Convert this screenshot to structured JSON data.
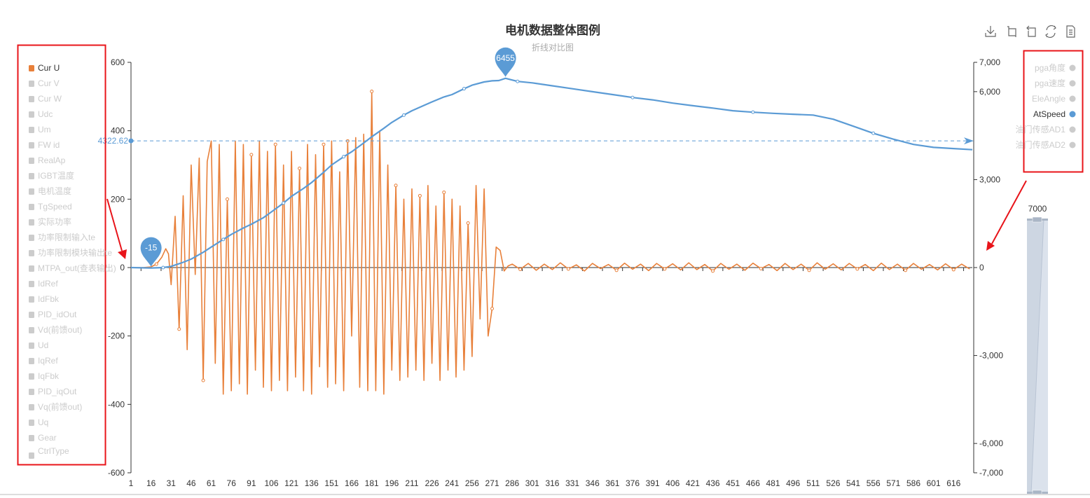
{
  "chart_data": {
    "type": "line",
    "title": "电机数据整体图例",
    "subtitle": "折线对比图",
    "x_range": [
      1,
      630
    ],
    "x_tick_labels": [
      "1",
      "16",
      "31",
      "46",
      "61",
      "76",
      "91",
      "106",
      "121",
      "136",
      "151",
      "166",
      "181",
      "196",
      "211",
      "226",
      "241",
      "256",
      "271",
      "286",
      "301",
      "316",
      "331",
      "346",
      "361",
      "376",
      "391",
      "406",
      "421",
      "436",
      "451",
      "466",
      "481",
      "496",
      "511",
      "526",
      "541",
      "556",
      "571",
      "586",
      "601",
      "616"
    ],
    "y_left": {
      "range": [
        -600,
        600
      ],
      "ticks": [
        "600",
        "400",
        "200",
        "0",
        "-200",
        "-400",
        "-600"
      ],
      "values": [
        600,
        400,
        200,
        0,
        -200,
        -400,
        -600
      ]
    },
    "y_right": {
      "range": [
        -7000,
        7000
      ],
      "ticks": [
        "7,000",
        "6,000",
        "3,000",
        "0",
        "-3,000",
        "-6,000",
        "-7,000"
      ],
      "values": [
        7000,
        6000,
        3000,
        0,
        -3000,
        -6000,
        -7000
      ]
    },
    "grid": false,
    "series": [
      {
        "name": "Cur U",
        "axis": "left",
        "color": "#e8803a",
        "points": [
          [
            1,
            0
          ],
          [
            10,
            0
          ],
          [
            16,
            2
          ],
          [
            20,
            10
          ],
          [
            24,
            30
          ],
          [
            27,
            55
          ],
          [
            29,
            40
          ],
          [
            31,
            -50
          ],
          [
            34,
            150
          ],
          [
            37,
            -180
          ],
          [
            40,
            210
          ],
          [
            43,
            -240
          ],
          [
            46,
            300
          ],
          [
            49,
            -20
          ],
          [
            52,
            320
          ],
          [
            55,
            -330
          ],
          [
            58,
            310
          ],
          [
            61,
            370
          ],
          [
            64,
            -280
          ],
          [
            67,
            360
          ],
          [
            70,
            -370
          ],
          [
            73,
            200
          ],
          [
            76,
            -360
          ],
          [
            79,
            370
          ],
          [
            82,
            -340
          ],
          [
            85,
            360
          ],
          [
            88,
            -370
          ],
          [
            91,
            330
          ],
          [
            94,
            -300
          ],
          [
            97,
            370
          ],
          [
            100,
            -350
          ],
          [
            103,
            340
          ],
          [
            106,
            -360
          ],
          [
            109,
            360
          ],
          [
            112,
            -330
          ],
          [
            115,
            300
          ],
          [
            118,
            -360
          ],
          [
            121,
            340
          ],
          [
            124,
            -320
          ],
          [
            127,
            290
          ],
          [
            130,
            -360
          ],
          [
            133,
            360
          ],
          [
            136,
            -370
          ],
          [
            139,
            330
          ],
          [
            142,
            -290
          ],
          [
            145,
            360
          ],
          [
            148,
            -350
          ],
          [
            151,
            370
          ],
          [
            154,
            -340
          ],
          [
            157,
            280
          ],
          [
            160,
            -360
          ],
          [
            163,
            370
          ],
          [
            166,
            -200
          ],
          [
            169,
            380
          ],
          [
            172,
            -350
          ],
          [
            175,
            390
          ],
          [
            178,
            -360
          ],
          [
            181,
            515
          ],
          [
            184,
            -360
          ],
          [
            187,
            400
          ],
          [
            190,
            -370
          ],
          [
            193,
            300
          ],
          [
            196,
            -300
          ],
          [
            199,
            240
          ],
          [
            202,
            -330
          ],
          [
            205,
            200
          ],
          [
            208,
            -320
          ],
          [
            211,
            230
          ],
          [
            214,
            -300
          ],
          [
            217,
            210
          ],
          [
            220,
            -330
          ],
          [
            223,
            240
          ],
          [
            226,
            -280
          ],
          [
            229,
            180
          ],
          [
            232,
            -330
          ],
          [
            235,
            220
          ],
          [
            238,
            -300
          ],
          [
            241,
            200
          ],
          [
            244,
            -320
          ],
          [
            247,
            180
          ],
          [
            250,
            -300
          ],
          [
            253,
            130
          ],
          [
            256,
            -260
          ],
          [
            259,
            240
          ],
          [
            262,
            -150
          ],
          [
            265,
            230
          ],
          [
            268,
            -200
          ],
          [
            271,
            -120
          ],
          [
            274,
            60
          ],
          [
            277,
            50
          ],
          [
            280,
            -10
          ],
          [
            283,
            5
          ],
          [
            286,
            10
          ],
          [
            292,
            -5
          ],
          [
            298,
            12
          ],
          [
            304,
            -8
          ],
          [
            310,
            10
          ],
          [
            316,
            -6
          ],
          [
            322,
            14
          ],
          [
            328,
            -4
          ],
          [
            334,
            8
          ],
          [
            340,
            -10
          ],
          [
            346,
            12
          ],
          [
            352,
            -3
          ],
          [
            358,
            9
          ],
          [
            364,
            -8
          ],
          [
            370,
            13
          ],
          [
            376,
            -5
          ],
          [
            382,
            10
          ],
          [
            388,
            -9
          ],
          [
            394,
            12
          ],
          [
            400,
            -4
          ],
          [
            406,
            11
          ],
          [
            412,
            -7
          ],
          [
            418,
            14
          ],
          [
            424,
            -6
          ],
          [
            430,
            9
          ],
          [
            436,
            -10
          ],
          [
            442,
            12
          ],
          [
            448,
            -5
          ],
          [
            454,
            10
          ],
          [
            460,
            -8
          ],
          [
            466,
            13
          ],
          [
            472,
            -3
          ],
          [
            478,
            9
          ],
          [
            484,
            -9
          ],
          [
            490,
            12
          ],
          [
            496,
            -6
          ],
          [
            502,
            10
          ],
          [
            508,
            -8
          ],
          [
            514,
            14
          ],
          [
            520,
            -5
          ],
          [
            526,
            11
          ],
          [
            532,
            -7
          ],
          [
            538,
            12
          ],
          [
            544,
            -4
          ],
          [
            550,
            9
          ],
          [
            556,
            -9
          ],
          [
            562,
            13
          ],
          [
            568,
            -6
          ],
          [
            574,
            10
          ],
          [
            580,
            -8
          ],
          [
            586,
            12
          ],
          [
            592,
            -5
          ],
          [
            598,
            9
          ],
          [
            604,
            -7
          ],
          [
            610,
            11
          ],
          [
            616,
            -6
          ],
          [
            622,
            10
          ],
          [
            628,
            -4
          ]
        ]
      },
      {
        "name": "AtSpeed",
        "axis": "right",
        "color": "#5b9bd5",
        "points": [
          [
            1,
            0
          ],
          [
            10,
            -10
          ],
          [
            16,
            -15
          ],
          [
            25,
            0
          ],
          [
            31,
            40
          ],
          [
            40,
            180
          ],
          [
            46,
            290
          ],
          [
            55,
            520
          ],
          [
            61,
            700
          ],
          [
            70,
            960
          ],
          [
            76,
            1130
          ],
          [
            85,
            1350
          ],
          [
            91,
            1480
          ],
          [
            100,
            1700
          ],
          [
            106,
            1900
          ],
          [
            115,
            2200
          ],
          [
            121,
            2430
          ],
          [
            130,
            2700
          ],
          [
            136,
            2900
          ],
          [
            145,
            3250
          ],
          [
            151,
            3500
          ],
          [
            160,
            3780
          ],
          [
            166,
            3950
          ],
          [
            175,
            4250
          ],
          [
            181,
            4460
          ],
          [
            190,
            4750
          ],
          [
            196,
            4950
          ],
          [
            205,
            5200
          ],
          [
            211,
            5350
          ],
          [
            220,
            5530
          ],
          [
            226,
            5650
          ],
          [
            235,
            5820
          ],
          [
            241,
            5900
          ],
          [
            250,
            6100
          ],
          [
            256,
            6220
          ],
          [
            265,
            6330
          ],
          [
            271,
            6370
          ],
          [
            276,
            6380
          ],
          [
            281,
            6455
          ],
          [
            290,
            6350
          ],
          [
            301,
            6300
          ],
          [
            316,
            6200
          ],
          [
            331,
            6100
          ],
          [
            346,
            6000
          ],
          [
            361,
            5900
          ],
          [
            376,
            5800
          ],
          [
            391,
            5720
          ],
          [
            406,
            5610
          ],
          [
            421,
            5520
          ],
          [
            436,
            5440
          ],
          [
            451,
            5350
          ],
          [
            466,
            5300
          ],
          [
            481,
            5260
          ],
          [
            496,
            5230
          ],
          [
            511,
            5200
          ],
          [
            526,
            5060
          ],
          [
            541,
            4820
          ],
          [
            556,
            4580
          ],
          [
            571,
            4380
          ],
          [
            586,
            4200
          ],
          [
            601,
            4100
          ],
          [
            616,
            4060
          ],
          [
            630,
            4020
          ]
        ],
        "mark_point_max": {
          "x": 281,
          "value": 6455,
          "label": "6455"
        },
        "mark_point_min": {
          "x": 16,
          "value": -15,
          "label": "-15"
        },
        "mark_line_average": {
          "value": 4322.62,
          "label": "4322.62"
        }
      }
    ],
    "legend_left": {
      "placement": "left",
      "items": [
        {
          "label": "Cur U",
          "active": true
        },
        {
          "label": "Cur V",
          "active": false
        },
        {
          "label": "Cur W",
          "active": false
        },
        {
          "label": "Udc",
          "active": false
        },
        {
          "label": "Um",
          "active": false
        },
        {
          "label": "FW id",
          "active": false
        },
        {
          "label": "RealAp",
          "active": false
        },
        {
          "label": "IGBT温度",
          "active": false
        },
        {
          "label": "电机温度",
          "active": false
        },
        {
          "label": "TgSpeed",
          "active": false
        },
        {
          "label": "实际功率",
          "active": false
        },
        {
          "label": "功率限制输入te",
          "active": false
        },
        {
          "label": "功率限制模块输出te",
          "active": false
        },
        {
          "label": "MTPA_out(查表输出)",
          "active": false
        },
        {
          "label": "IdRef",
          "active": false
        },
        {
          "label": "IdFbk",
          "active": false
        },
        {
          "label": "PID_idOut",
          "active": false
        },
        {
          "label": "Vd(前馈out)",
          "active": false
        },
        {
          "label": "Ud",
          "active": false
        },
        {
          "label": "IqRef",
          "active": false
        },
        {
          "label": "IqFbk",
          "active": false
        },
        {
          "label": "PID_iqOut",
          "active": false
        },
        {
          "label": "Vq(前馈out)",
          "active": false
        },
        {
          "label": "Uq",
          "active": false
        },
        {
          "label": "Gear",
          "active": false
        },
        {
          "label": "CtrlType",
          "active": false
        }
      ]
    },
    "legend_right": {
      "placement": "right",
      "items": [
        {
          "label": "pga角度",
          "active": false
        },
        {
          "label": "pga速度",
          "active": false
        },
        {
          "label": "EleAngle",
          "active": false
        },
        {
          "label": "AtSpeed",
          "active": true
        },
        {
          "label": "油门传感AD1",
          "active": false
        },
        {
          "label": "油门传感AD2",
          "active": false
        }
      ]
    },
    "data_zoom": {
      "orientation": "vertical",
      "label": "7000",
      "start_percent": 0,
      "end_percent": 100
    }
  },
  "toolbox": [
    {
      "icon": "download-icon"
    },
    {
      "icon": "data-zoom-icon"
    },
    {
      "icon": "zoom-reset-icon"
    },
    {
      "icon": "restore-icon"
    },
    {
      "icon": "data-view-icon"
    }
  ],
  "colors": {
    "active_orange": "#e8803a",
    "active_blue": "#5b9bd5",
    "inactive": "#cccccc",
    "annotation_red": "#e8141a"
  }
}
